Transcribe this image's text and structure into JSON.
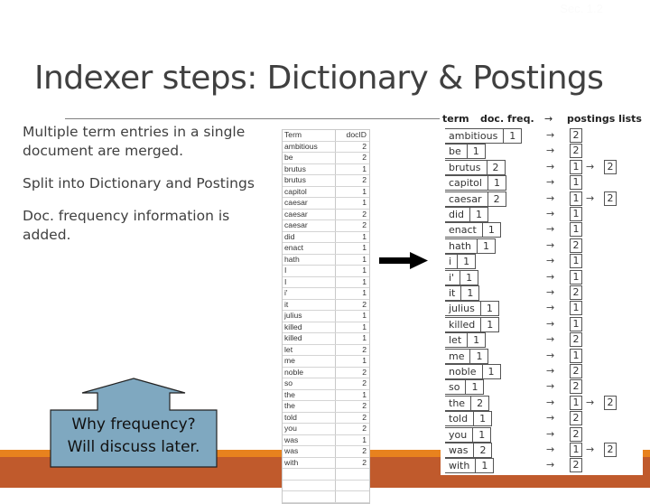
{
  "slide": {
    "number": "Sec. 1.2",
    "title": "Indexer steps: Dictionary & Postings",
    "bullets": [
      "Multiple term entries in a single document are merged.",
      "Split into Dictionary and Postings",
      "Doc. frequency information is added."
    ],
    "callout": {
      "line1": "Why frequency?",
      "line2": "Will discuss later."
    },
    "colors": {
      "accent_orange": "#e8821e",
      "accent_rust": "#c05a2c",
      "callout_fill": "#7fa8c0"
    }
  },
  "sorted_table": {
    "headers": [
      "Term",
      "docID"
    ],
    "rows": [
      [
        "ambitious",
        "2"
      ],
      [
        "be",
        "2"
      ],
      [
        "brutus",
        "1"
      ],
      [
        "brutus",
        "2"
      ],
      [
        "capitol",
        "1"
      ],
      [
        "caesar",
        "1"
      ],
      [
        "caesar",
        "2"
      ],
      [
        "caesar",
        "2"
      ],
      [
        "did",
        "1"
      ],
      [
        "enact",
        "1"
      ],
      [
        "hath",
        "1"
      ],
      [
        "I",
        "1"
      ],
      [
        "I",
        "1"
      ],
      [
        "i'",
        "1"
      ],
      [
        "it",
        "2"
      ],
      [
        "julius",
        "1"
      ],
      [
        "killed",
        "1"
      ],
      [
        "killed",
        "1"
      ],
      [
        "let",
        "2"
      ],
      [
        "me",
        "1"
      ],
      [
        "noble",
        "2"
      ],
      [
        "so",
        "2"
      ],
      [
        "the",
        "1"
      ],
      [
        "the",
        "2"
      ],
      [
        "told",
        "2"
      ],
      [
        "you",
        "2"
      ],
      [
        "was",
        "1"
      ],
      [
        "was",
        "2"
      ],
      [
        "with",
        "2"
      ],
      [
        "",
        ""
      ],
      [
        "",
        ""
      ],
      [
        "",
        ""
      ]
    ]
  },
  "dictionary": {
    "headers": {
      "term": "term",
      "freq": "doc. freq.",
      "arrow": "→",
      "postings": "postings lists"
    },
    "arrow_glyph": "→",
    "entries": [
      {
        "term": "ambitious",
        "freq": "1",
        "postings": [
          "2"
        ]
      },
      {
        "term": "be",
        "freq": "1",
        "postings": [
          "2"
        ]
      },
      {
        "term": "brutus",
        "freq": "2",
        "postings": [
          "1",
          "2"
        ]
      },
      {
        "term": "capitol",
        "freq": "1",
        "postings": [
          "1"
        ]
      },
      {
        "term": "caesar",
        "freq": "2",
        "postings": [
          "1",
          "2"
        ]
      },
      {
        "term": "did",
        "freq": "1",
        "postings": [
          "1"
        ]
      },
      {
        "term": "enact",
        "freq": "1",
        "postings": [
          "1"
        ]
      },
      {
        "term": "hath",
        "freq": "1",
        "postings": [
          "2"
        ]
      },
      {
        "term": "i",
        "freq": "1",
        "postings": [
          "1"
        ]
      },
      {
        "term": "i'",
        "freq": "1",
        "postings": [
          "1"
        ]
      },
      {
        "term": "it",
        "freq": "1",
        "postings": [
          "2"
        ]
      },
      {
        "term": "julius",
        "freq": "1",
        "postings": [
          "1"
        ]
      },
      {
        "term": "killed",
        "freq": "1",
        "postings": [
          "1"
        ]
      },
      {
        "term": "let",
        "freq": "1",
        "postings": [
          "2"
        ]
      },
      {
        "term": "me",
        "freq": "1",
        "postings": [
          "1"
        ]
      },
      {
        "term": "noble",
        "freq": "1",
        "postings": [
          "2"
        ]
      },
      {
        "term": "so",
        "freq": "1",
        "postings": [
          "2"
        ]
      },
      {
        "term": "the",
        "freq": "2",
        "postings": [
          "1",
          "2"
        ]
      },
      {
        "term": "told",
        "freq": "1",
        "postings": [
          "2"
        ]
      },
      {
        "term": "you",
        "freq": "1",
        "postings": [
          "2"
        ]
      },
      {
        "term": "was",
        "freq": "2",
        "postings": [
          "1",
          "2"
        ]
      },
      {
        "term": "with",
        "freq": "1",
        "postings": [
          "2"
        ]
      }
    ]
  }
}
